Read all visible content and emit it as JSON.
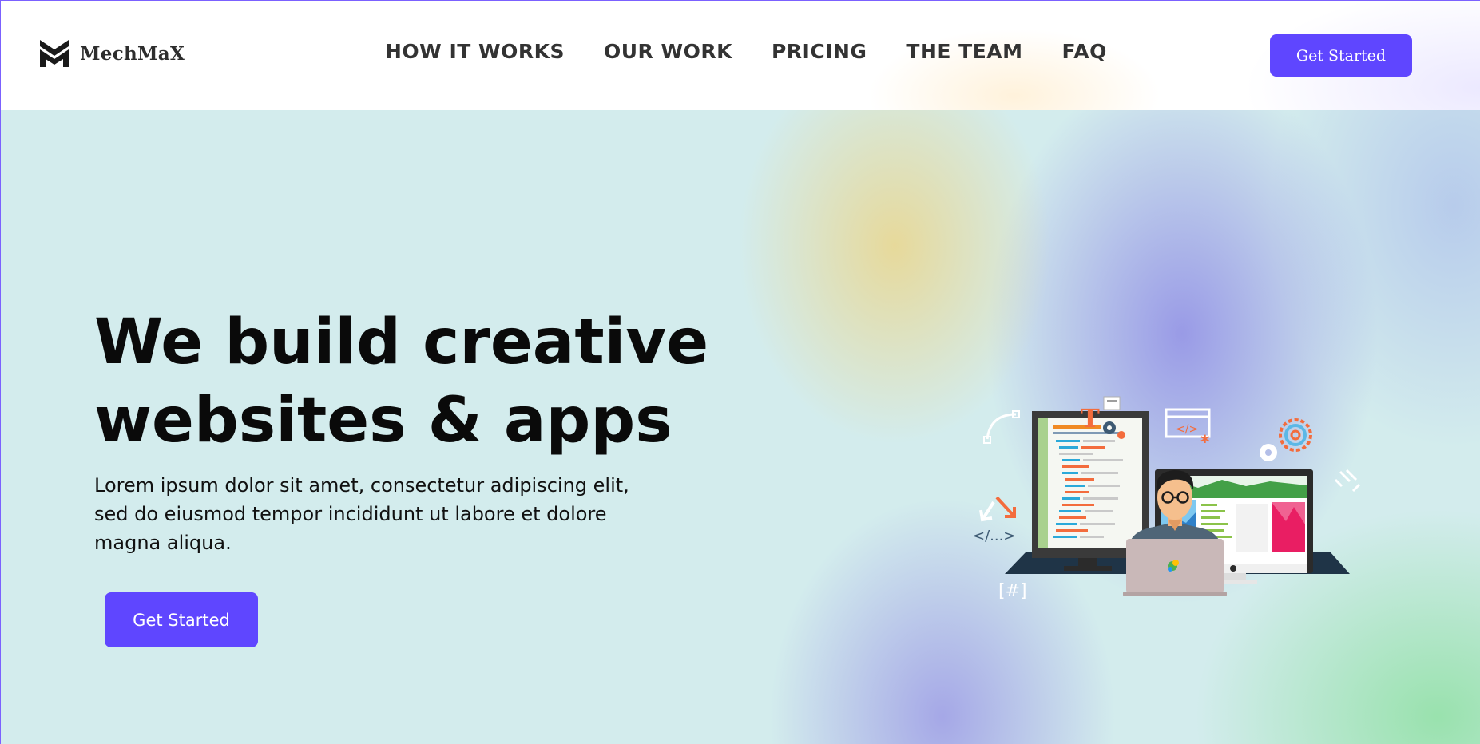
{
  "brand": {
    "name": "MechMaX",
    "icon": "mechmax-logo-icon",
    "primary_color": "#5f46ff"
  },
  "nav": {
    "items": [
      {
        "label": "HOW IT WORKS"
      },
      {
        "label": "OUR WORK"
      },
      {
        "label": "PRICING"
      },
      {
        "label": "THE TEAM"
      },
      {
        "label": "FAQ"
      }
    ]
  },
  "header": {
    "cta_label": "Get Started"
  },
  "hero": {
    "headline_line1": "We build creative",
    "headline_line2": "websites & apps",
    "subtext": "Lorem ipsum dolor sit amet, consectetur adipiscing elit, sed do eiusmod tempor incididunt ut labore et dolore magna aliqua.",
    "cta_label": "Get Started",
    "illustration": {
      "icon": "developer-workspace-illustration",
      "code_tag": "</...>",
      "hash_tag": "[#]",
      "text_tool": "T",
      "code_window": "</>"
    }
  }
}
